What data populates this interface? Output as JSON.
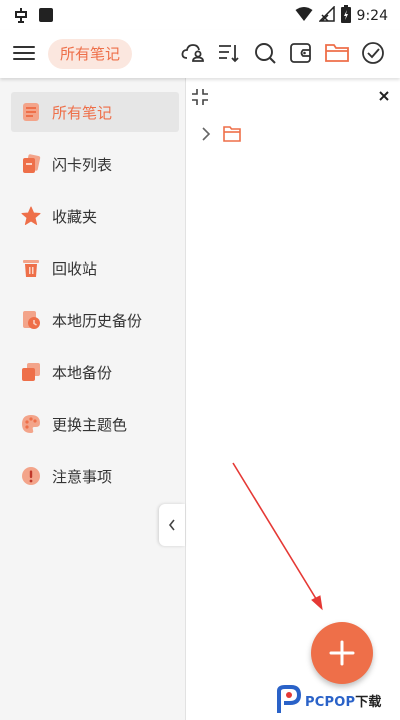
{
  "status_bar": {
    "left_icons": [
      "bug-app-icon",
      "square-notification-icon"
    ],
    "right_icons": [
      "wifi-icon",
      "no-signal-icon",
      "battery-charging-icon"
    ],
    "time": "9:24"
  },
  "app_bar": {
    "title": "所有笔记",
    "toolbar_icons": [
      "cloud-user-icon",
      "sort-icon",
      "search-icon",
      "wallet-icon",
      "folder-icon",
      "check-circle-icon"
    ],
    "accent_color": "#ee6f49"
  },
  "sidebar": {
    "items": [
      {
        "label": "所有笔记",
        "icon": "note-icon",
        "active": true
      },
      {
        "label": "闪卡列表",
        "icon": "flashcard-icon",
        "active": false
      },
      {
        "label": "收藏夹",
        "icon": "star-icon",
        "active": false
      },
      {
        "label": "回收站",
        "icon": "trash-icon",
        "active": false
      },
      {
        "label": "本地历史备份",
        "icon": "history-backup-icon",
        "active": false
      },
      {
        "label": "本地备份",
        "icon": "backup-icon",
        "active": false
      },
      {
        "label": "更换主题色",
        "icon": "palette-icon",
        "active": false
      },
      {
        "label": "注意事项",
        "icon": "warning-icon",
        "active": false
      }
    ]
  },
  "content": {
    "tree": [
      {
        "icon": "folder-icon",
        "expanded": false
      }
    ]
  },
  "fab": {
    "icon": "plus-icon"
  },
  "watermark": {
    "brand": "PCPOP",
    "suffix": "下载"
  }
}
